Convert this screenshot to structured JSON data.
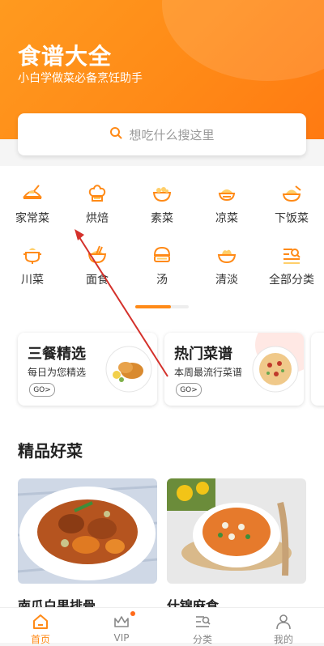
{
  "header": {
    "title": "食谱大全",
    "subtitle": "小白学做菜必备烹饪助手"
  },
  "search": {
    "placeholder": "想吃什么搜这里",
    "icon": "search-icon"
  },
  "categories": [
    {
      "label": "家常菜",
      "icon": "home-dish-icon"
    },
    {
      "label": "烘焙",
      "icon": "chef-hat-icon"
    },
    {
      "label": "素菜",
      "icon": "vegetable-bowl-icon"
    },
    {
      "label": "凉菜",
      "icon": "cold-dish-icon"
    },
    {
      "label": "下饭菜",
      "icon": "rice-dish-icon"
    },
    {
      "label": "川菜",
      "icon": "hotpot-icon"
    },
    {
      "label": "面食",
      "icon": "noodle-icon"
    },
    {
      "label": "汤",
      "icon": "soup-icon"
    },
    {
      "label": "清淡",
      "icon": "light-dish-icon"
    },
    {
      "label": "全部分类",
      "icon": "list-icon"
    }
  ],
  "promo_cards": [
    {
      "title": "三餐精选",
      "subtitle": "每日为您精选",
      "go_label": "GO>"
    },
    {
      "title": "热门菜谱",
      "subtitle": "本周最流行菜谱",
      "go_label": "GO>"
    }
  ],
  "section": {
    "title": "精品好菜"
  },
  "dishes": [
    {
      "name": "南瓜白果排骨"
    },
    {
      "name": "什锦麻食"
    }
  ],
  "tabbar": [
    {
      "label": "首页",
      "icon": "home-icon",
      "active": true
    },
    {
      "label": "VIP",
      "icon": "crown-icon",
      "active": false,
      "badge": true
    },
    {
      "label": "分类",
      "icon": "category-search-icon",
      "active": false
    },
    {
      "label": "我的",
      "icon": "user-icon",
      "active": false
    }
  ],
  "colors": {
    "accent": "#ff8a17",
    "annotation_arrow": "#d4312b"
  }
}
